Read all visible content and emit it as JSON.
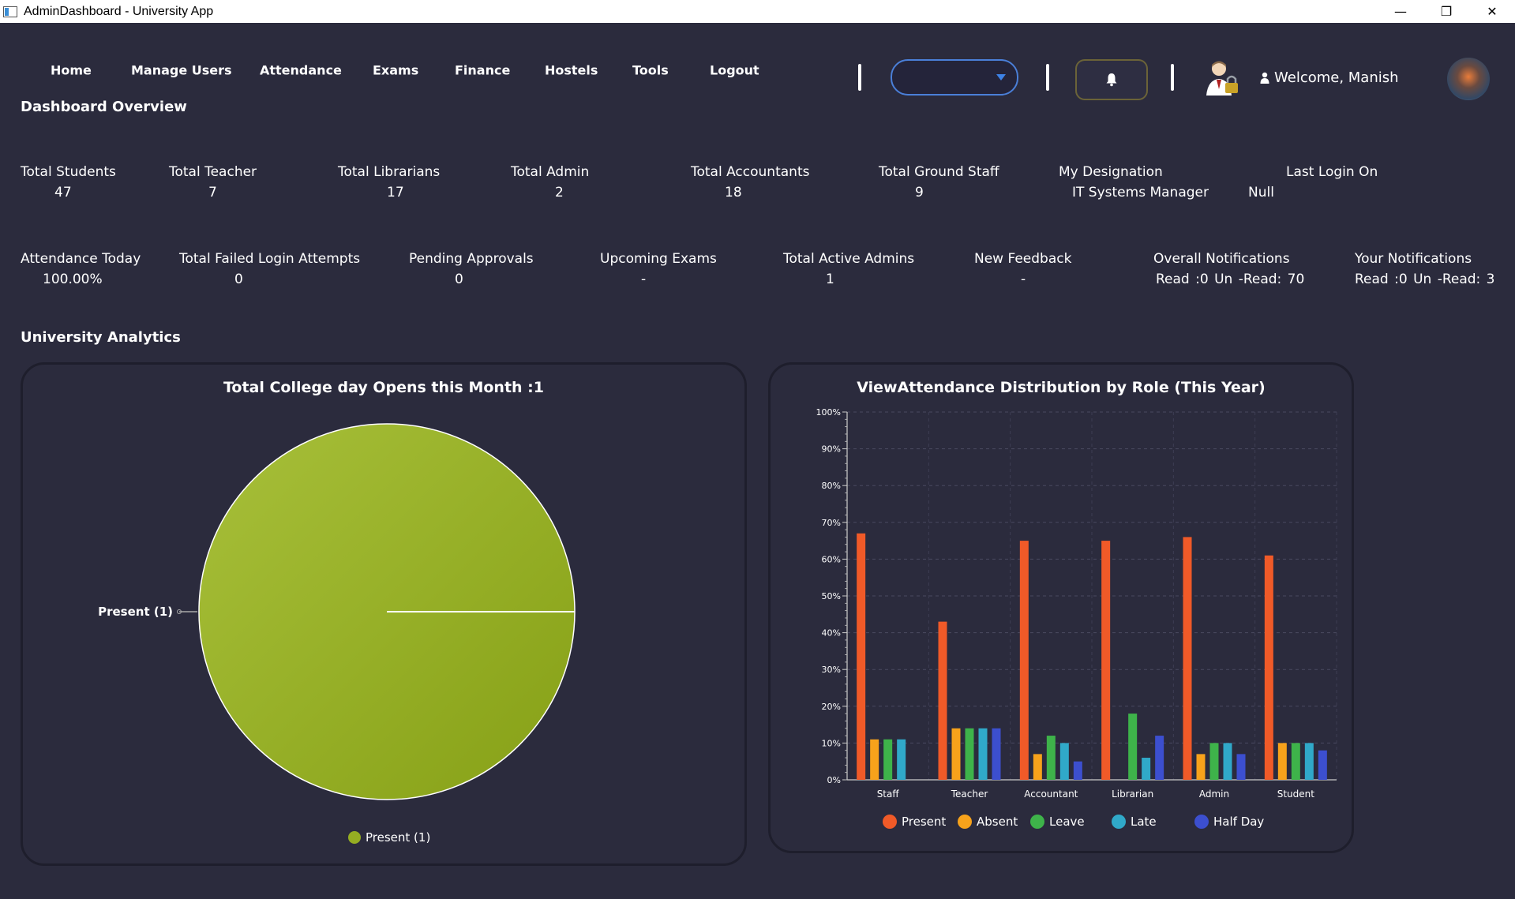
{
  "window": {
    "title": "AdminDashboard - University App"
  },
  "nav": {
    "items": [
      "Home",
      "Manage Users",
      "Attendance",
      "Exams",
      "Finance",
      "Hostels",
      "Tools",
      "Logout"
    ],
    "role_select_value": "",
    "welcome": "Welcome, Manish"
  },
  "overview": {
    "title": "Dashboard Overview",
    "row1": [
      {
        "label": "Total Students",
        "value": "47"
      },
      {
        "label": "Total Teacher",
        "value": "7"
      },
      {
        "label": "Total Librarians",
        "value": "17"
      },
      {
        "label": "Total Admin",
        "value": "2"
      },
      {
        "label": "Total Accountants",
        "value": "18"
      },
      {
        "label": "Total Ground Staff",
        "value": "9"
      },
      {
        "label": "My Designation",
        "value": "IT Systems Manager"
      },
      {
        "label": "Last Login On",
        "value": "Null"
      }
    ],
    "row2": [
      {
        "label": "Attendance Today",
        "value": "100.00%"
      },
      {
        "label": "Total Failed Login Attempts",
        "value": "0"
      },
      {
        "label": "Pending Approvals",
        "value": "0"
      },
      {
        "label": "Upcoming Exams",
        "value": "-"
      },
      {
        "label": "Total Active Admins",
        "value": "1"
      },
      {
        "label": "New Feedback",
        "value": "-"
      },
      {
        "label": "Overall Notifications",
        "value": "Read :0   Un -Read: 70"
      },
      {
        "label": "Your Notifications",
        "value": "Read :0   Un -Read: 3"
      }
    ]
  },
  "analytics": {
    "title": "University Analytics"
  },
  "chart_data": [
    {
      "type": "pie",
      "title": "Total College day Opens this Month :1",
      "labels": [
        "Present (1)"
      ],
      "values": [
        1
      ],
      "colors": [
        "#95ad22"
      ],
      "legend": [
        "Present (1)"
      ],
      "legend_position": "bottom"
    },
    {
      "type": "bar",
      "title": "ViewAttendance Distribution by Role (This Year)",
      "categories": [
        "Staff",
        "Teacher",
        "Accountant",
        "Librarian",
        "Admin",
        "Student"
      ],
      "ylim": [
        0,
        100
      ],
      "yticks": [
        "0%",
        "10%",
        "20%",
        "30%",
        "40%",
        "50%",
        "60%",
        "70%",
        "80%",
        "90%",
        "100%"
      ],
      "grid": true,
      "legend_position": "bottom",
      "series": [
        {
          "name": "Present",
          "color": "#f05a28",
          "values": [
            67,
            43,
            65,
            65,
            66,
            61
          ]
        },
        {
          "name": "Absent",
          "color": "#f7a21b",
          "values": [
            11,
            14,
            7,
            0,
            7,
            10
          ]
        },
        {
          "name": "Leave",
          "color": "#3eb34a",
          "values": [
            11,
            14,
            12,
            18,
            10,
            10
          ]
        },
        {
          "name": "Late",
          "color": "#30a9c9",
          "values": [
            11,
            14,
            10,
            6,
            10,
            10
          ]
        },
        {
          "name": "Half Day",
          "color": "#3c4fcf",
          "values": [
            0,
            14,
            5,
            12,
            7,
            8
          ]
        }
      ]
    }
  ]
}
